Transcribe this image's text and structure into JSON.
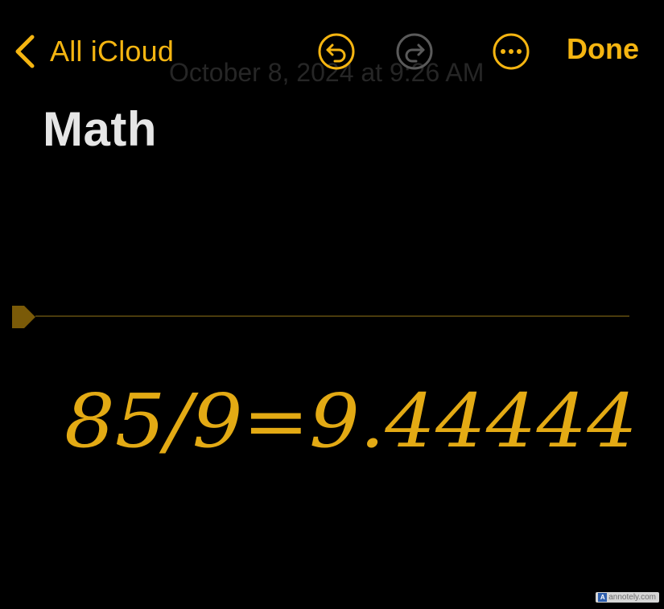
{
  "nav": {
    "back_label": "All iCloud",
    "done_label": "Done"
  },
  "header": {
    "date_text": "October 8, 2024 at 9:26 AM"
  },
  "note": {
    "title": "Math",
    "handwritten_expression": "85/9=9.44444"
  },
  "watermark": {
    "text": "annotely.com",
    "logo_letter": "A"
  },
  "colors": {
    "accent": "#f5b511",
    "ink": "#e3aa14",
    "disabled": "#5a5a5a",
    "background": "#000000"
  },
  "icons": [
    "chevron-left-icon",
    "undo-icon",
    "redo-icon",
    "more-icon",
    "ruler-handle-icon"
  ]
}
